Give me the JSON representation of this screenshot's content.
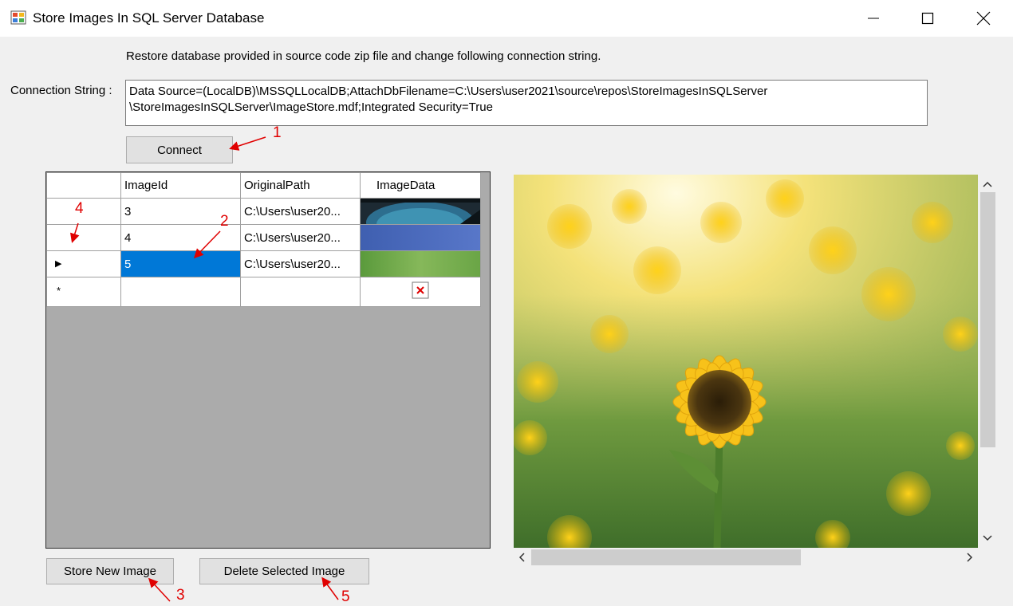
{
  "window": {
    "title": "Store Images In SQL Server Database",
    "minimize_icon": "minimize-icon",
    "maximize_icon": "maximize-icon",
    "close_icon": "close-icon"
  },
  "instruction": "Restore database provided in source code zip file and change following connection string.",
  "connection": {
    "label": "Connection String :",
    "value": "Data Source=(LocalDB)\\MSSQLLocalDB;AttachDbFilename=C:\\Users\\user2021\\source\\repos\\StoreImagesInSQLServer\n\\StoreImagesInSQLServer\\ImageStore.mdf;Integrated Security=True"
  },
  "buttons": {
    "connect": "Connect",
    "store_new": "Store New Image",
    "delete_selected": "Delete Selected Image"
  },
  "grid": {
    "columns": [
      "ImageId",
      "OriginalPath",
      "ImageData"
    ],
    "rows": [
      {
        "id": "3",
        "path": "C:\\Users\\user20...",
        "image": "blue-lens-thumbnail"
      },
      {
        "id": "4",
        "path": "C:\\Users\\user20...",
        "image": "blue-gradient-thumbnail"
      },
      {
        "id": "5",
        "path": "C:\\Users\\user20...",
        "image": "green-grass-thumbnail",
        "selected": true
      }
    ],
    "new_row_marker": "*",
    "current_row_marker": "▶"
  },
  "annotations": [
    "1",
    "2",
    "3",
    "4",
    "5"
  ],
  "colors": {
    "selection": "#0078d7",
    "annotation": "#e00000",
    "grid_background": "#ababab"
  }
}
